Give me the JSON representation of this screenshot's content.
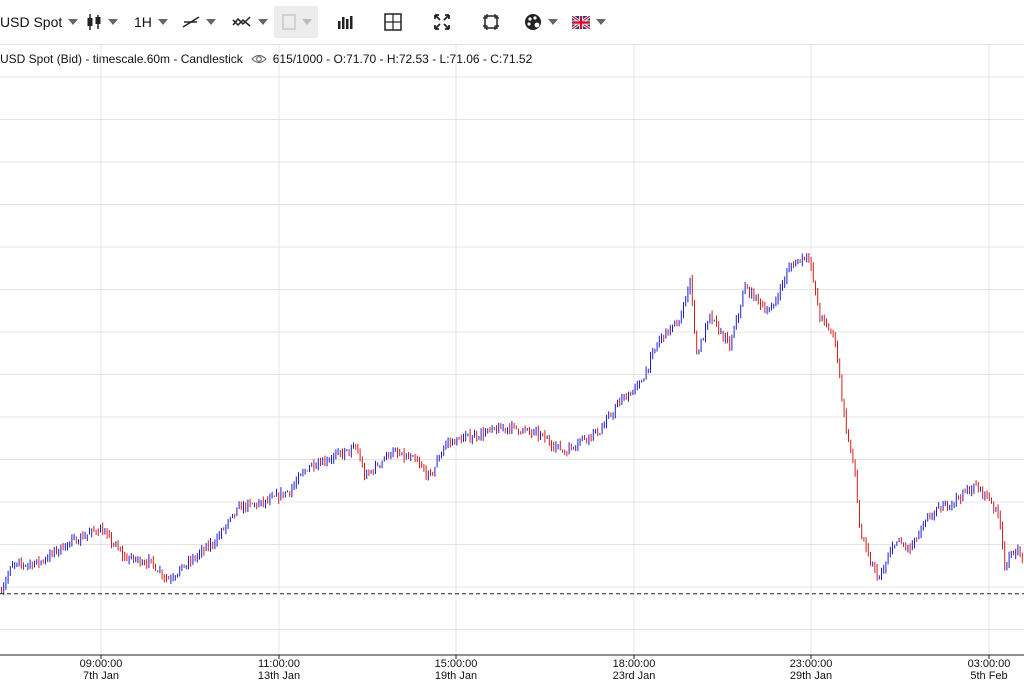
{
  "toolbar": {
    "symbol": "USD Spot",
    "interval": "1H",
    "icons": [
      "candlestick-icon",
      "trendline-icon",
      "drawing-tools-icon",
      "indicator-disabled-icon",
      "bar-chart-icon",
      "crosshair-icon",
      "fullscreen-icon",
      "fit-icon",
      "palette-icon",
      "uk-flag-icon"
    ]
  },
  "header": {
    "description": "USD Spot (Bid) - timescale.60m - Candlestick",
    "ohlc": "615/1000 - O:71.70 - H:72.53 - L:71.06 - C:71.52"
  },
  "colors": {
    "up": "#1e1ed2",
    "down": "#d21e1e",
    "wick": "#333333",
    "grid": "#e4e4e4"
  },
  "chart_data": {
    "type": "candlestick",
    "title": "USD Spot (Bid) - timescale.60m - Candlestick",
    "x_ticks": [
      {
        "time": "09:00:00",
        "date": "7th Jan"
      },
      {
        "time": "11:00:00",
        "date": "13th Jan"
      },
      {
        "time": "15:00:00",
        "date": "19th Jan"
      },
      {
        "time": "18:00:00",
        "date": "23rd Jan"
      },
      {
        "time": "23:00:00",
        "date": "29th Jan"
      },
      {
        "time": "03:00:00",
        "date": "5th Feb"
      }
    ],
    "ylim": [
      69.3,
      83.0
    ],
    "reference_level": 70.75,
    "price_path": [
      [
        0,
        70.8
      ],
      [
        12,
        71.4
      ],
      [
        40,
        71.5
      ],
      [
        65,
        71.9
      ],
      [
        100,
        72.3
      ],
      [
        125,
        71.6
      ],
      [
        150,
        71.5
      ],
      [
        168,
        71.1
      ],
      [
        190,
        71.5
      ],
      [
        215,
        72.0
      ],
      [
        240,
        72.8
      ],
      [
        265,
        72.9
      ],
      [
        290,
        73.2
      ],
      [
        310,
        73.8
      ],
      [
        335,
        74.0
      ],
      [
        357,
        74.2
      ],
      [
        365,
        73.5
      ],
      [
        390,
        74.1
      ],
      [
        415,
        73.9
      ],
      [
        430,
        73.5
      ],
      [
        445,
        74.3
      ],
      [
        475,
        74.5
      ],
      [
        510,
        74.7
      ],
      [
        540,
        74.5
      ],
      [
        565,
        74.1
      ],
      [
        580,
        74.4
      ],
      [
        600,
        74.6
      ],
      [
        620,
        75.3
      ],
      [
        640,
        75.7
      ],
      [
        660,
        76.8
      ],
      [
        680,
        77.2
      ],
      [
        690,
        78.2
      ],
      [
        697,
        76.4
      ],
      [
        710,
        77.3
      ],
      [
        730,
        76.6
      ],
      [
        745,
        78.0
      ],
      [
        770,
        77.4
      ],
      [
        790,
        78.5
      ],
      [
        808,
        78.8
      ],
      [
        820,
        77.3
      ],
      [
        835,
        76.8
      ],
      [
        845,
        74.8
      ],
      [
        855,
        73.6
      ],
      [
        860,
        72.2
      ],
      [
        870,
        71.5
      ],
      [
        880,
        71.1
      ],
      [
        895,
        72.0
      ],
      [
        910,
        71.8
      ],
      [
        930,
        72.6
      ],
      [
        950,
        72.9
      ],
      [
        975,
        73.3
      ],
      [
        990,
        73.0
      ],
      [
        1000,
        72.5
      ],
      [
        1005,
        71.4
      ],
      [
        1015,
        71.8
      ],
      [
        1024,
        71.6
      ]
    ]
  }
}
